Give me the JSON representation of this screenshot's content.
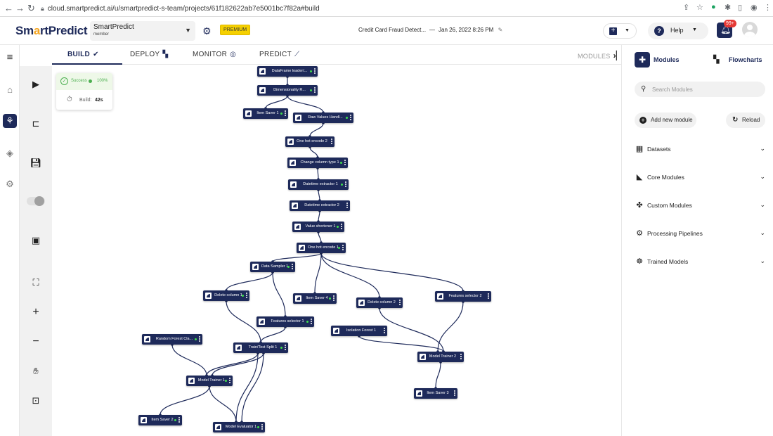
{
  "browser": {
    "url": "cloud.smartpredict.ai/u/smartpredict-s-team/projects/61f182622ab7e5001bc7f82a#build"
  },
  "header": {
    "logo": {
      "part1": "Sm",
      "part2": "a",
      "part3": "rtPredict"
    },
    "project_name": "SmartPredict",
    "project_role": "member",
    "premium_label": "PREMIUM",
    "doc_title": "Credit Card Fraud Detect...",
    "doc_sep": "—",
    "doc_date": "Jan 26, 2022 8:26 PM",
    "help_label": "Help",
    "notification_count": "99+"
  },
  "tabs": [
    {
      "label": "BUILD",
      "icon": "check-circle-icon"
    },
    {
      "label": "DEPLOY",
      "icon": "deploy-icon"
    },
    {
      "label": "MONITOR",
      "icon": "globe-icon"
    },
    {
      "label": "PREDICT",
      "icon": "chart-icon"
    }
  ],
  "modules_toggle_label": "MODULES",
  "status": {
    "state": "Success",
    "percent": "100%",
    "build_label": "Build:",
    "build_time": "42s",
    "color": "#4caf50"
  },
  "graph": {
    "nodes": [
      {
        "id": "dfl",
        "label": "DataFrame loader/..."
      },
      {
        "id": "dr",
        "label": "Dimensionality R..."
      },
      {
        "id": "is1",
        "label": "Item Saver 1"
      },
      {
        "id": "rvh",
        "label": "Raw Values Handl..."
      },
      {
        "id": "ohe2",
        "label": "One hot encode 2"
      },
      {
        "id": "cct",
        "label": "Change column type 1"
      },
      {
        "id": "de1",
        "label": "Datetime extractor 1"
      },
      {
        "id": "de2",
        "label": "Datetime extractor 2"
      },
      {
        "id": "vs1",
        "label": "Value shortener 1"
      },
      {
        "id": "ohe1",
        "label": "One hot encode 1"
      },
      {
        "id": "ds1",
        "label": "Data Sampler 1"
      },
      {
        "id": "dc1",
        "label": "Delete column 1"
      },
      {
        "id": "is4",
        "label": "Item Saver 4"
      },
      {
        "id": "dc2",
        "label": "Delete column 2"
      },
      {
        "id": "fs2",
        "label": "Features selector 2"
      },
      {
        "id": "fs1",
        "label": "Features selector 1"
      },
      {
        "id": "if1",
        "label": "Isolation Forest 1"
      },
      {
        "id": "rfc",
        "label": "Random Forest Cla..."
      },
      {
        "id": "tts",
        "label": "Train/Test Split 1"
      },
      {
        "id": "mt2",
        "label": "Model Trainer 2"
      },
      {
        "id": "mt1",
        "label": "Model Trainer 1"
      },
      {
        "id": "is3",
        "label": "Item Saver 3"
      },
      {
        "id": "is2",
        "label": "Item Saver 2"
      },
      {
        "id": "me1",
        "label": "Model Evaluator 1"
      }
    ]
  },
  "right_panel": {
    "modules_tab": "Modules",
    "flowcharts_tab": "Flowcharts",
    "search_placeholder": "Search Modules",
    "add_module": "Add new module",
    "reload": "Reload",
    "categories": [
      {
        "label": "Datasets",
        "icon": "grid-icon"
      },
      {
        "label": "Core Modules",
        "icon": "leaf-icon"
      },
      {
        "label": "Custom Modules",
        "icon": "puzzle-icon"
      },
      {
        "label": "Processing Pipelines",
        "icon": "pipeline-icon"
      },
      {
        "label": "Trained Models",
        "icon": "brain-icon"
      }
    ]
  },
  "colors": {
    "accent": "#1e2a5a",
    "premium": "#f5d000",
    "notification": "#e53935"
  }
}
